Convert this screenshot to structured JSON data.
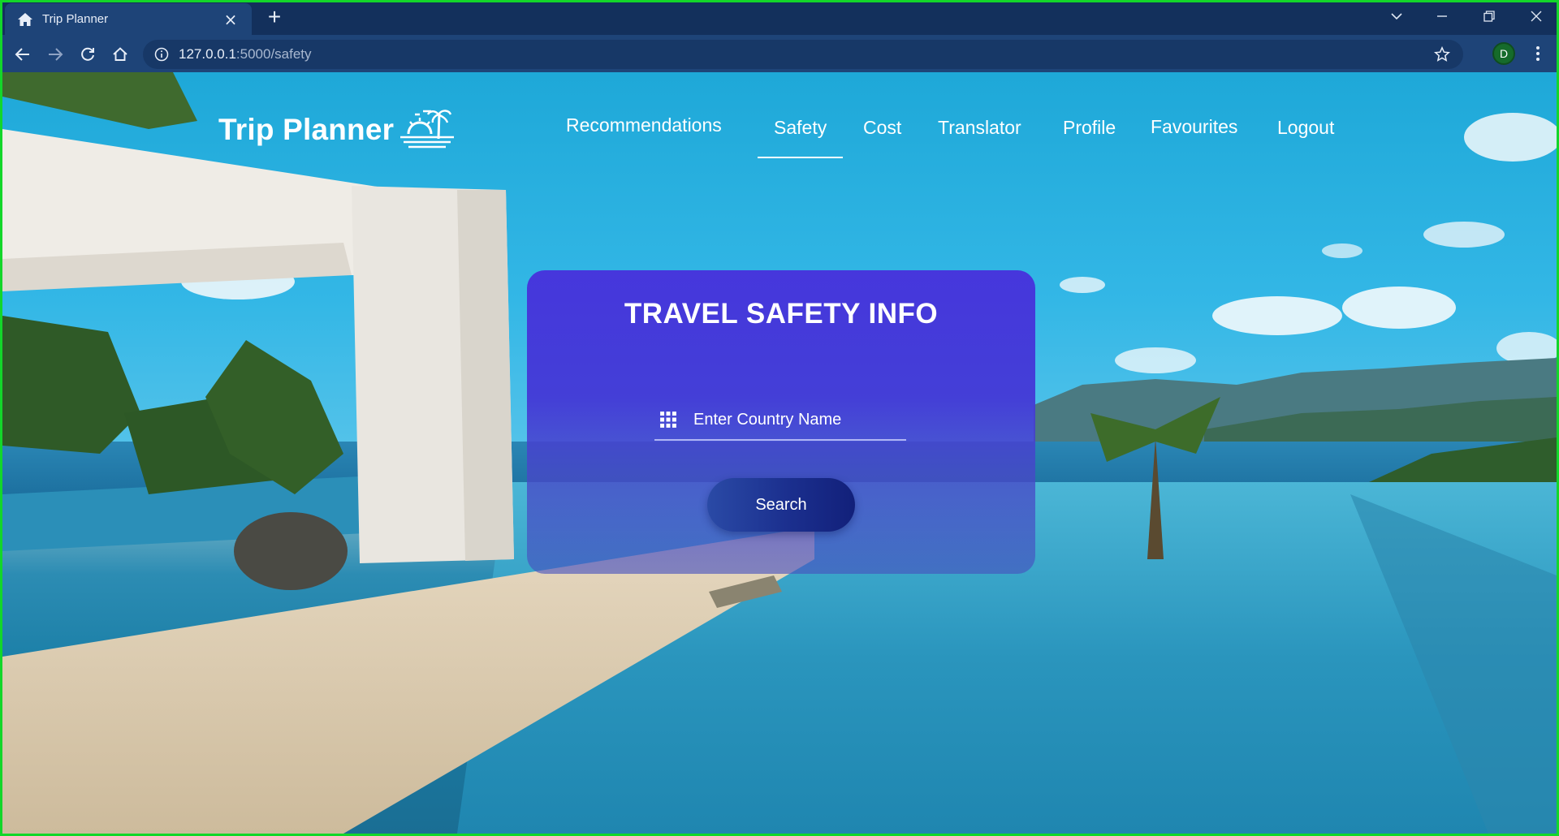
{
  "browser": {
    "tab_title": "Trip Planner",
    "tab_close": "×",
    "new_tab": "+",
    "url_host": "127.0.0.1",
    "url_path": ":5000/safety",
    "profile_initial": "D"
  },
  "nav": {
    "brand": "Trip Planner",
    "items": [
      "Recommendations",
      "Safety",
      "Cost",
      "Translator",
      "Profile",
      "Favourites",
      "Logout"
    ],
    "active": "Safety"
  },
  "safety_card": {
    "title": "TRAVEL SAFETY INFO",
    "country_placeholder": "Enter Country Name",
    "search_label": "Search"
  },
  "colors": {
    "chrome_dark": "#13305c",
    "chrome": "#1e4478",
    "card": "#4634dc",
    "button": "#1b2f8e",
    "frame": "#13d62a"
  }
}
